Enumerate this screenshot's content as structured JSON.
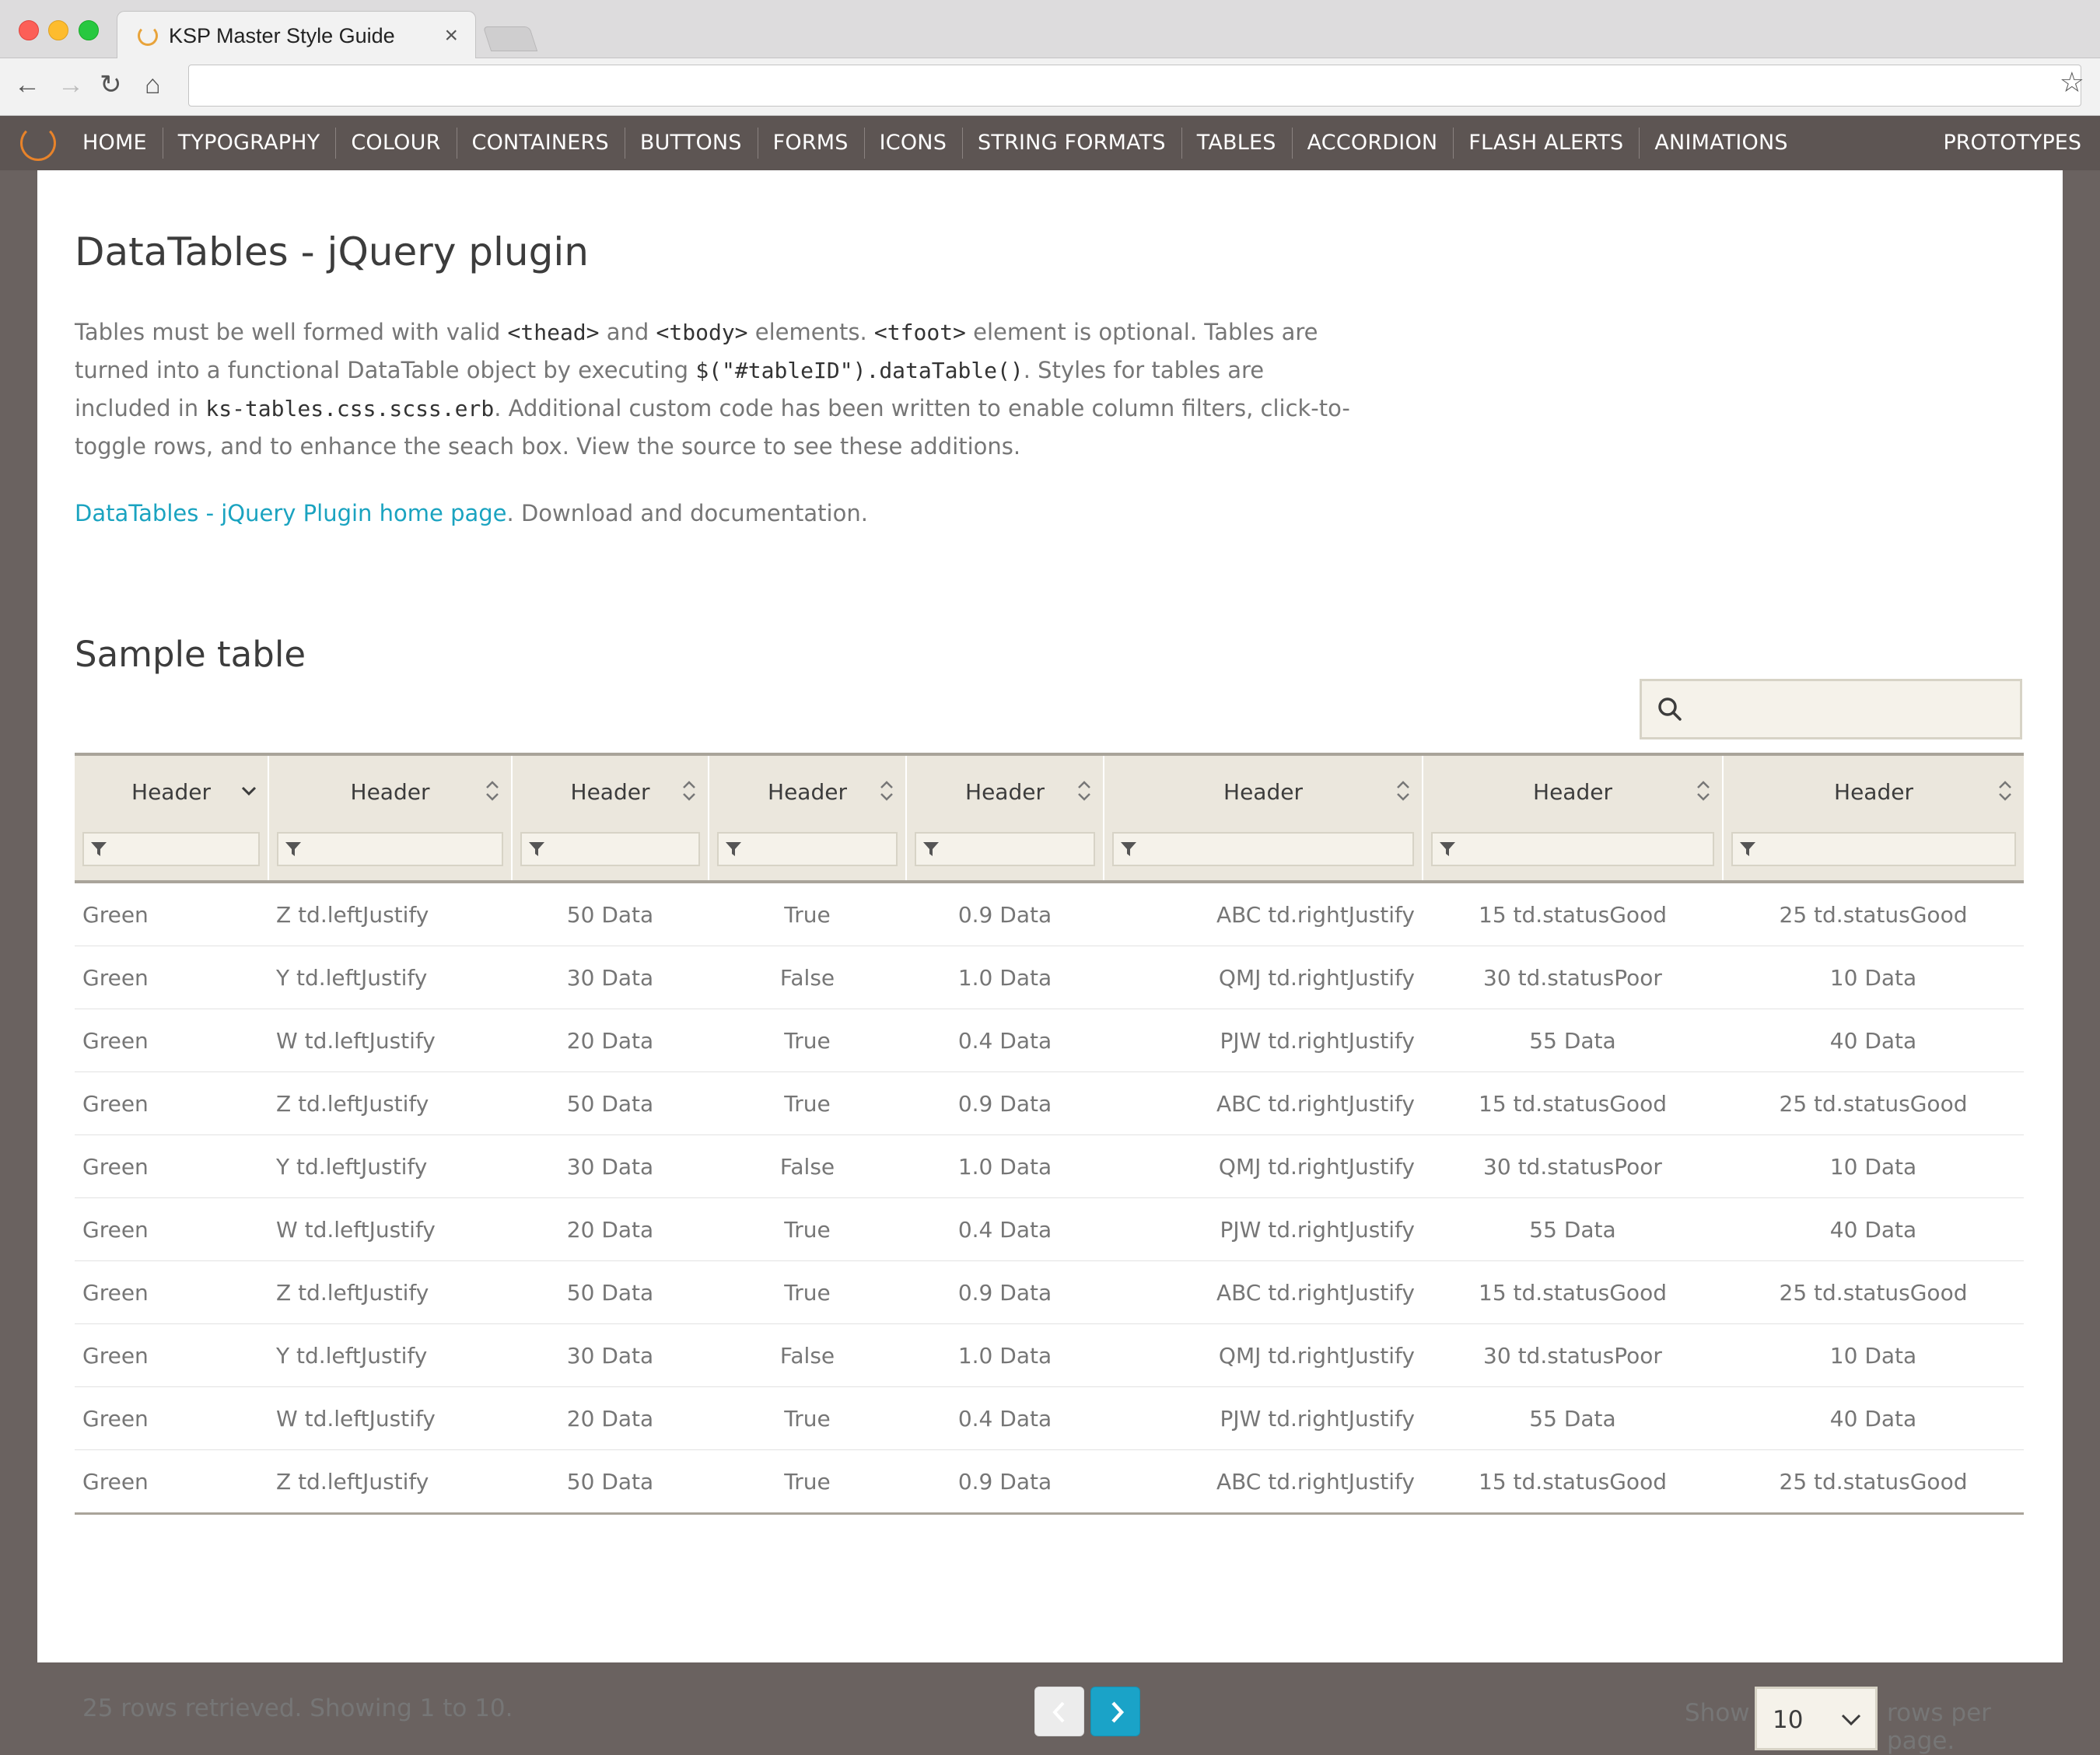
{
  "browser": {
    "tab_title": "KSP Master Style Guide",
    "tab_close": "×",
    "address": ""
  },
  "nav": {
    "items": [
      "HOME",
      "TYPOGRAPHY",
      "COLOUR",
      "CONTAINERS",
      "BUTTONS",
      "FORMS",
      "ICONS",
      "STRING FORMATS",
      "TABLES",
      "ACCORDION",
      "FLASH ALERTS",
      "ANIMATIONS"
    ],
    "right": "PROTOTYPES"
  },
  "page": {
    "title": "DataTables - jQuery plugin",
    "desc": {
      "p1": "Tables must be well formed with valid ",
      "code1": "<thead>",
      "p2": " and ",
      "code2": "<tbody>",
      "p3": " elements. ",
      "code3": "<tfoot>",
      "p4": " element is optional. Tables are turned into a functional DataTable object by executing ",
      "code4": "$(\"#tableID\").dataTable()",
      "p5": ". Styles for tables are included in ",
      "code5": "ks-tables.css.scss.erb",
      "p6": ". Additional custom code has been written to enable column filters, click-to-toggle rows, and to enhance the seach box. View the source to see these additions."
    },
    "link_text": "DataTables - jQuery Plugin home page",
    "link_suffix": ". Download and documentation.",
    "section_title": "Sample table"
  },
  "search": {
    "value": "",
    "placeholder": ""
  },
  "table": {
    "headers": [
      "Header",
      "Header",
      "Header",
      "Header",
      "Header",
      "Header",
      "Header",
      "Header"
    ],
    "rows": [
      [
        "Green",
        "Z td.leftJustify",
        "50 Data",
        "True",
        "0.9 Data",
        "ABC td.rightJustify",
        "15 td.statusGood",
        "25 td.statusGood"
      ],
      [
        "Green",
        "Y td.leftJustify",
        "30 Data",
        "False",
        "1.0 Data",
        "QMJ td.rightJustify",
        "30 td.statusPoor",
        "10 Data"
      ],
      [
        "Green",
        "W td.leftJustify",
        "20 Data",
        "True",
        "0.4 Data",
        "PJW td.rightJustify",
        "55 Data",
        "40 Data"
      ],
      [
        "Green",
        "Z td.leftJustify",
        "50 Data",
        "True",
        "0.9 Data",
        "ABC td.rightJustify",
        "15 td.statusGood",
        "25 td.statusGood"
      ],
      [
        "Green",
        "Y td.leftJustify",
        "30 Data",
        "False",
        "1.0 Data",
        "QMJ td.rightJustify",
        "30 td.statusPoor",
        "10 Data"
      ],
      [
        "Green",
        "W td.leftJustify",
        "20 Data",
        "True",
        "0.4 Data",
        "PJW td.rightJustify",
        "55 Data",
        "40 Data"
      ],
      [
        "Green",
        "Z td.leftJustify",
        "50 Data",
        "True",
        "0.9 Data",
        "ABC td.rightJustify",
        "15 td.statusGood",
        "25 td.statusGood"
      ],
      [
        "Green",
        "Y td.leftJustify",
        "30 Data",
        "False",
        "1.0 Data",
        "QMJ td.rightJustify",
        "30 td.statusPoor",
        "10 Data"
      ],
      [
        "Green",
        "W td.leftJustify",
        "20 Data",
        "True",
        "0.4 Data",
        "PJW td.rightJustify",
        "55 Data",
        "40 Data"
      ],
      [
        "Green",
        "Z td.leftJustify",
        "50 Data",
        "True",
        "0.9 Data",
        "ABC td.rightJustify",
        "15 td.statusGood",
        "25 td.statusGood"
      ]
    ]
  },
  "footer": {
    "summary": "25 rows retrieved. Showing 1 to 10.",
    "show_label": "Show",
    "rows_value": "10",
    "rows_label": "rows per page."
  },
  "colors": {
    "nav_bg": "#5d5553",
    "accent_link": "#1aa3c0",
    "next_button": "#1aa3c8",
    "logo": "#e8832a"
  }
}
